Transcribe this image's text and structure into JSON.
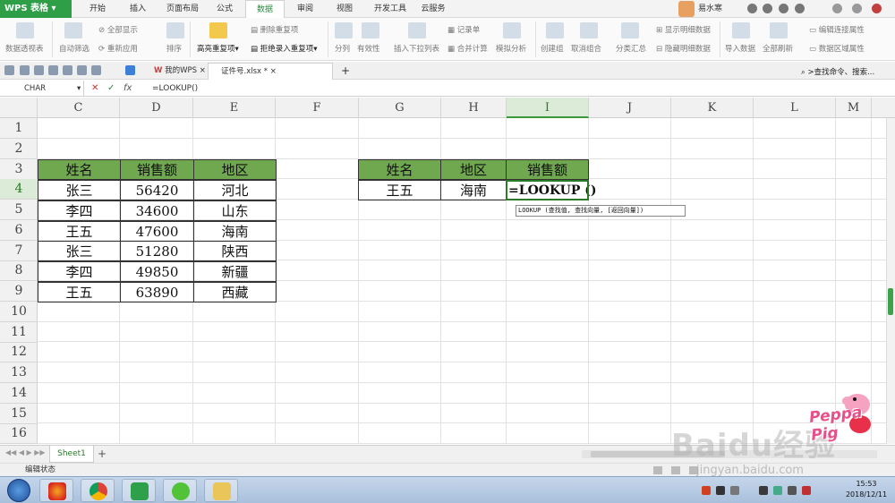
{
  "app": {
    "name": "WPS 表格"
  },
  "menu": [
    "开始",
    "插入",
    "页面布局",
    "公式",
    "数据",
    "审阅",
    "视图",
    "开发工具",
    "云服务"
  ],
  "menu_active_index": 4,
  "user": {
    "name": "易水寒"
  },
  "ribbon": {
    "pivot": "数据透视表",
    "autofilter": "自动筛选",
    "show_all": "全部显示",
    "reapply": "重新应用",
    "sort": "排序",
    "highlight_dup": "高亮重复项",
    "delete_dup": "删除重复项",
    "reject_dup": "拒绝录入重复项",
    "split": "分列",
    "validity": "有效性",
    "insert_dropdown": "插入下拉列表",
    "record": "记录单",
    "consolidate": "合并计算",
    "simulate": "模拟分析",
    "create_group": "创建组",
    "ungroup": "取消组合",
    "subtotal": "分类汇总",
    "show_detail": "显示明细数据",
    "hide_detail": "隐藏明细数据",
    "import": "导入数据",
    "refresh_all": "全部刷新",
    "edit_links": "编辑连接属性",
    "data_area": "数据区域属性"
  },
  "tabs": {
    "mywps": "我的WPS",
    "file": "证件号.xlsx *"
  },
  "search_cmd": ">查找命令、搜索...",
  "formula_bar": {
    "name_box": "CHAR",
    "fx": "fx",
    "formula": "=LOOKUP()"
  },
  "columns": [
    "C",
    "D",
    "E",
    "F",
    "G",
    "H",
    "I",
    "J",
    "K",
    "L",
    "M"
  ],
  "selected_column": "I",
  "rows": [
    "1",
    "2",
    "3",
    "4",
    "5",
    "6",
    "7",
    "8",
    "9",
    "10",
    "11",
    "12",
    "13",
    "14",
    "15",
    "16"
  ],
  "selected_row": "4",
  "table1": {
    "headers": [
      "姓名",
      "销售额",
      "地区"
    ],
    "rows": [
      [
        "张三",
        "56420",
        "河北"
      ],
      [
        "李四",
        "34600",
        "山东"
      ],
      [
        "王五",
        "47600",
        "海南"
      ],
      [
        "张三",
        "51280",
        "陕西"
      ],
      [
        "李四",
        "49850",
        "新疆"
      ],
      [
        "王五",
        "63890",
        "西藏"
      ]
    ]
  },
  "table2": {
    "headers": [
      "姓名",
      "地区",
      "销售额"
    ],
    "row": [
      "王五",
      "海南",
      "=LOOKUP ()"
    ]
  },
  "tooltip": "LOOKUP (查找值, 查找向量, [返回向量])",
  "sheet": {
    "tab": "Sheet1",
    "add": "+"
  },
  "status": "编辑状态",
  "watermark": {
    "text": "Baidu经验",
    "url": "jingyan.baidu.com"
  },
  "peppa": "Peppa Pig",
  "clock": {
    "time": "15:53",
    "date": "2018/12/11"
  }
}
